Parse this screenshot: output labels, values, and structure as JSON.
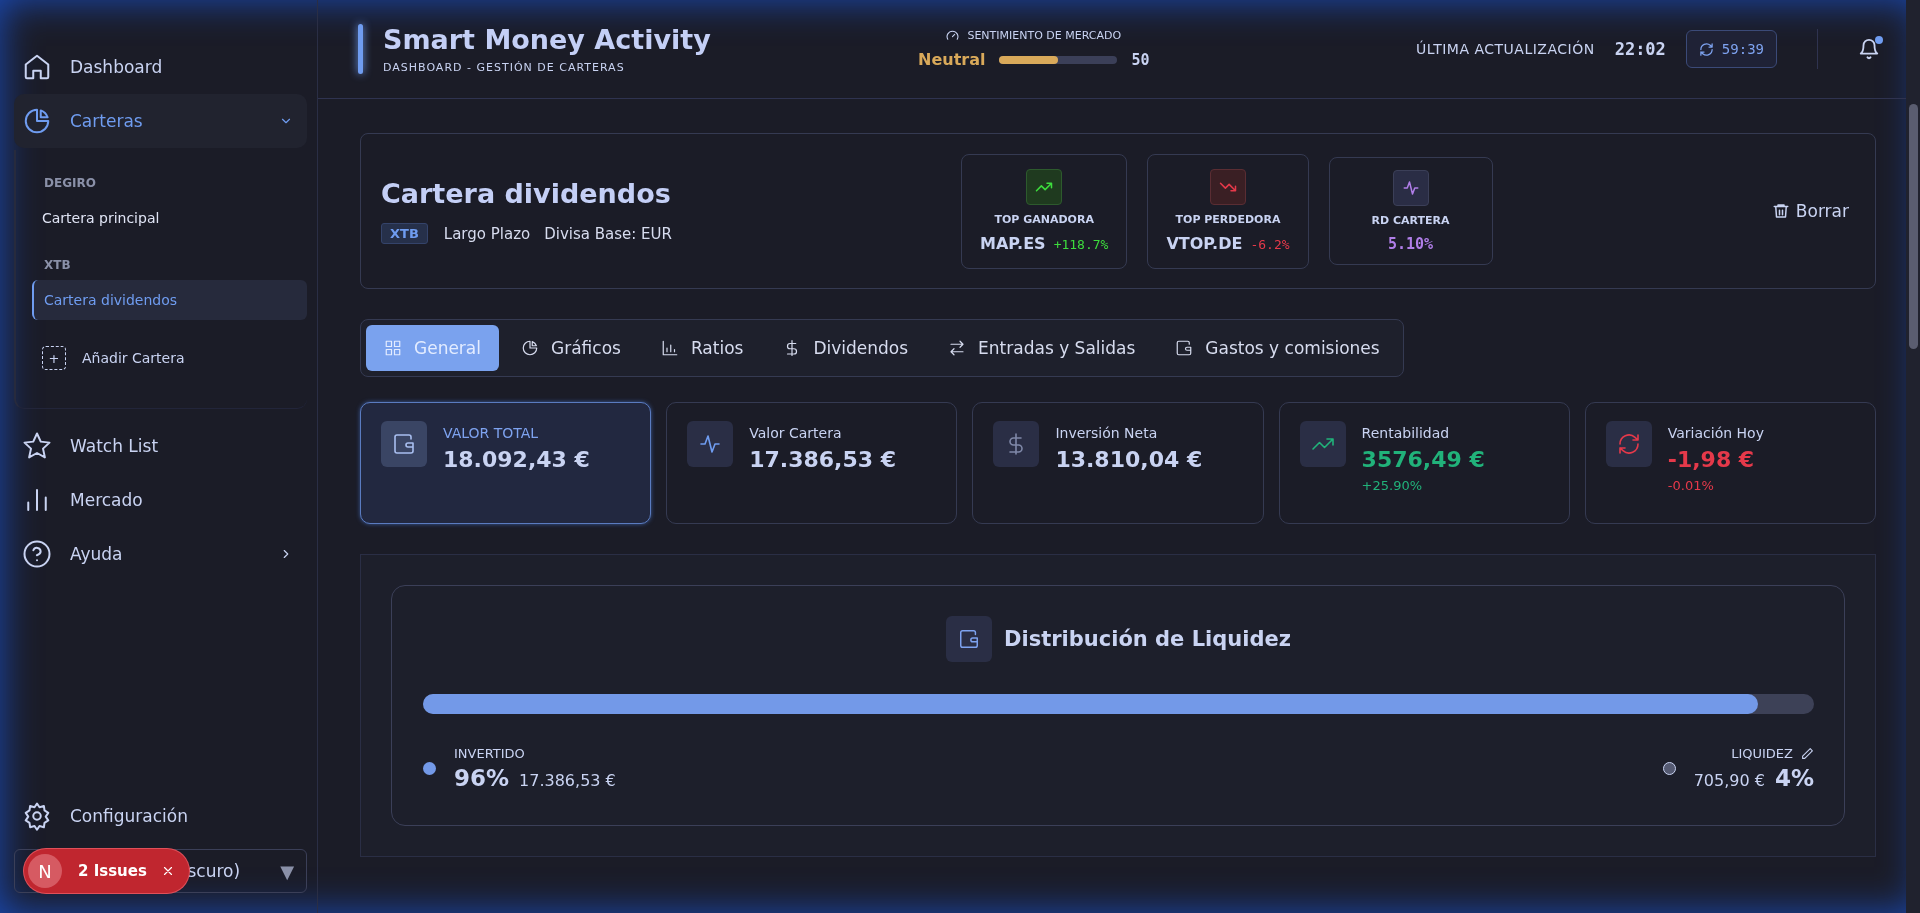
{
  "sidebar": {
    "items": [
      {
        "label": "Dashboard",
        "selected": false
      },
      {
        "label": "Carteras",
        "selected": true,
        "expanded": true,
        "children": [
          {
            "kind": "group",
            "label": "DEGIRO"
          },
          {
            "kind": "item",
            "label": "Cartera principal",
            "selected": false
          },
          {
            "kind": "group",
            "label": "XTB"
          },
          {
            "kind": "item",
            "label": "Cartera dividendos",
            "selected": true
          },
          {
            "kind": "add",
            "label": "Añadir Cartera",
            "symbol": "+"
          }
        ]
      },
      {
        "label": "Watch List",
        "selected": false
      },
      {
        "label": "Mercado",
        "selected": false
      },
      {
        "label": "Ayuda",
        "selected": false,
        "expanded": false
      }
    ],
    "settings": "Configuración",
    "theme_select": {
      "value": "scuro)",
      "caret": "▼"
    }
  },
  "dev_badge": {
    "logo": "N",
    "label": "2 Issues"
  },
  "header": {
    "title": "Smart Money Activity",
    "subtitle": "DASHBOARD - GESTIÓN DE CARTERAS",
    "sentiment": {
      "label": "SENTIMIENTO DE MERCADO",
      "value": "Neutral",
      "level": 0.5,
      "reading": "50"
    },
    "update": {
      "label": "ÚLTIMA ACTUALIZACIÓN",
      "time": "22:02",
      "countdown": "59:39"
    },
    "notifications": {
      "unread": true
    }
  },
  "portfolio": {
    "name": "Cartera dividendos",
    "broker": "XTB",
    "tags": [
      "Largo Plazo",
      "Divisa Base: EUR"
    ],
    "highlights": [
      {
        "kind": "gain",
        "label": "TOP GANADORA",
        "ticker": "MAP.ES",
        "value": "+118.7%"
      },
      {
        "kind": "loss",
        "label": "TOP PERDEDORA",
        "ticker": "VTOP.DE",
        "value": "-6.2%"
      },
      {
        "kind": "yield",
        "label": "RD CARTERA",
        "value": "5.10%"
      }
    ],
    "delete": "Borrar"
  },
  "tabs": [
    {
      "label": "General",
      "selected": true
    },
    {
      "label": "Gráficos",
      "selected": false
    },
    {
      "label": "Ratios",
      "selected": false
    },
    {
      "label": "Dividendos",
      "selected": false
    },
    {
      "label": "Entradas y Salidas",
      "selected": false
    },
    {
      "label": "Gastos y comisiones",
      "selected": false
    }
  ],
  "stats": [
    {
      "kind": "plain",
      "label": "VALOR TOTAL",
      "value": "18.092,43 €",
      "selected": true
    },
    {
      "kind": "plain",
      "label": "Valor Cartera",
      "value": "17.386,53 €",
      "selected": false
    },
    {
      "kind": "plain",
      "label": "Inversión Neta",
      "value": "13.810,04 €",
      "selected": false
    },
    {
      "kind": "gain",
      "label": "Rentabilidad",
      "value": "3576,49 €",
      "change": "+25.90%",
      "selected": false
    },
    {
      "kind": "loss",
      "label": "Variación Hoy",
      "value": "-1,98 €",
      "change": "-0.01%",
      "selected": false
    }
  ],
  "liquidity": {
    "title": "Distribución de Liquidez",
    "level": 0.96,
    "invested": {
      "label": "INVERTIDO",
      "percent": "96%",
      "amount": "17.386,53 €"
    },
    "cash": {
      "label": "LIQUIDEZ",
      "amount": "705,90 €",
      "percent": "4%"
    }
  }
}
